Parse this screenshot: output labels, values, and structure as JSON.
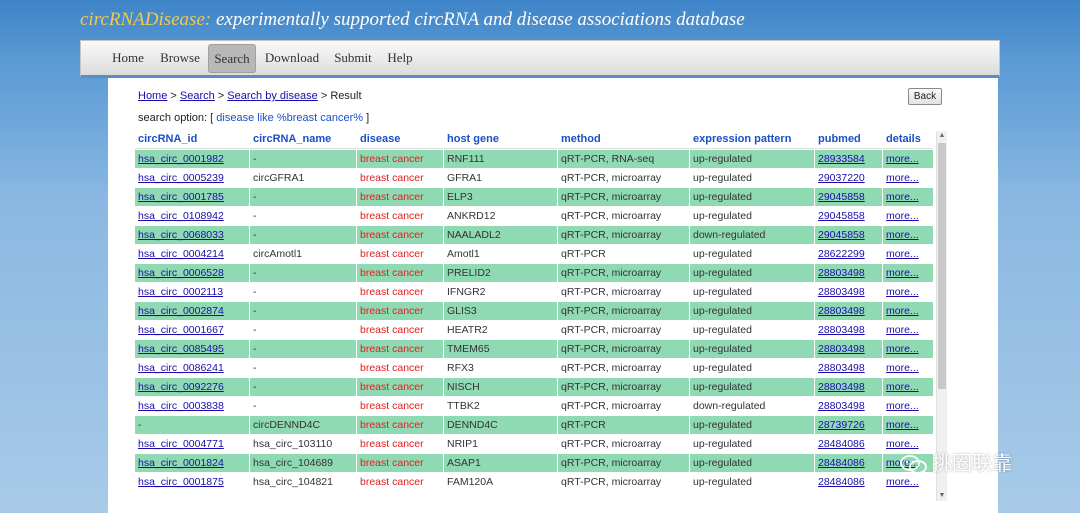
{
  "header": {
    "brand": "circRNADisease:",
    "tagline": " experimentally supported circRNA and disease associations database"
  },
  "nav": {
    "items": [
      "Home",
      "Browse",
      "Search",
      "Download",
      "Submit",
      "Help"
    ],
    "active": "Search"
  },
  "breadcrumb": {
    "home": "Home",
    "sep1": " > ",
    "search": "Search",
    "sep2": " > ",
    "by_disease": "Search by disease",
    "sep3": " > ",
    "current": "Result"
  },
  "back_label": "Back",
  "search_option": {
    "prefix": "search option: [ ",
    "query": "disease like %breast cancer%",
    "suffix": " ]"
  },
  "table": {
    "columns": [
      "circRNA_id",
      "circRNA_name",
      "disease",
      "host gene",
      "method",
      "expression pattern",
      "pubmed",
      "details"
    ],
    "rows": [
      [
        "hsa_circ_0001982",
        "-",
        "breast cancer",
        "RNF111",
        "qRT-PCR, RNA-seq",
        "up-regulated",
        "28933584",
        "more..."
      ],
      [
        "hsa_circ_0005239",
        "circGFRA1",
        "breast cancer",
        "GFRA1",
        "qRT-PCR, microarray",
        "up-regulated",
        "29037220",
        "more..."
      ],
      [
        "hsa_circ_0001785",
        "-",
        "breast cancer",
        "ELP3",
        "qRT-PCR, microarray",
        "up-regulated",
        "29045858",
        "more..."
      ],
      [
        "hsa_circ_0108942",
        "-",
        "breast cancer",
        "ANKRD12",
        "qRT-PCR, microarray",
        "up-regulated",
        "29045858",
        "more..."
      ],
      [
        "hsa_circ_0068033",
        "-",
        "breast cancer",
        "NAALADL2",
        "qRT-PCR, microarray",
        "down-regulated",
        "29045858",
        "more..."
      ],
      [
        "hsa_circ_0004214",
        "circAmotl1",
        "breast cancer",
        "Amotl1",
        "qRT-PCR",
        "up-regulated",
        "28622299",
        "more..."
      ],
      [
        "hsa_circ_0006528",
        "-",
        "breast cancer",
        "PRELID2",
        "qRT-PCR, microarray",
        "up-regulated",
        "28803498",
        "more..."
      ],
      [
        "hsa_circ_0002113",
        "-",
        "breast cancer",
        "IFNGR2",
        "qRT-PCR, microarray",
        "up-regulated",
        "28803498",
        "more..."
      ],
      [
        "hsa_circ_0002874",
        "-",
        "breast cancer",
        "GLIS3",
        "qRT-PCR, microarray",
        "up-regulated",
        "28803498",
        "more..."
      ],
      [
        "hsa_circ_0001667",
        "-",
        "breast cancer",
        "HEATR2",
        "qRT-PCR, microarray",
        "up-regulated",
        "28803498",
        "more..."
      ],
      [
        "hsa_circ_0085495",
        "-",
        "breast cancer",
        "TMEM65",
        "qRT-PCR, microarray",
        "up-regulated",
        "28803498",
        "more..."
      ],
      [
        "hsa_circ_0086241",
        "-",
        "breast cancer",
        "RFX3",
        "qRT-PCR, microarray",
        "up-regulated",
        "28803498",
        "more..."
      ],
      [
        "hsa_circ_0092276",
        "-",
        "breast cancer",
        "NISCH",
        "qRT-PCR, microarray",
        "up-regulated",
        "28803498",
        "more..."
      ],
      [
        "hsa_circ_0003838",
        "-",
        "breast cancer",
        "TTBK2",
        "qRT-PCR, microarray",
        "down-regulated",
        "28803498",
        "more..."
      ],
      [
        "-",
        "circDENND4C",
        "breast cancer",
        "DENND4C",
        "qRT-PCR",
        "up-regulated",
        "28739726",
        "more..."
      ],
      [
        "hsa_circ_0004771",
        "hsa_circ_103110",
        "breast cancer",
        "NRIP1",
        "qRT-PCR, microarray",
        "up-regulated",
        "28484086",
        "more..."
      ],
      [
        "hsa_circ_0001824",
        "hsa_circ_104689",
        "breast cancer",
        "ASAP1",
        "qRT-PCR, microarray",
        "up-regulated",
        "28484086",
        "more..."
      ],
      [
        "hsa_circ_0001875",
        "hsa_circ_104821",
        "breast cancer",
        "FAM120A",
        "qRT-PCR, microarray",
        "up-regulated",
        "28484086",
        "more..."
      ]
    ]
  },
  "watermark": "挑圈联靠",
  "colors": {
    "row_highlight": "#8fd9b3",
    "disease_text": "#e02020",
    "header_text": "#1a4fc9",
    "link": "#1a0dab"
  }
}
